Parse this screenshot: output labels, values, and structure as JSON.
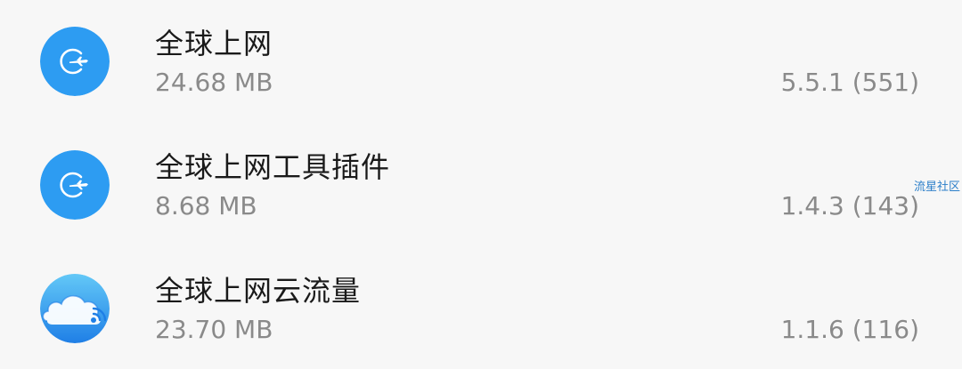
{
  "apps": [
    {
      "name": "全球上网",
      "size": "24.68 MB",
      "version": "5.5.1 (551)",
      "icon": "airplane-globe-icon"
    },
    {
      "name": "全球上网工具插件",
      "size": "8.68 MB",
      "version": "1.4.3 (143)",
      "icon": "airplane-globe-icon"
    },
    {
      "name": "全球上网云流量",
      "size": "23.70 MB",
      "version": "1.1.6 (116)",
      "icon": "cloud-signal-icon"
    }
  ],
  "watermark": "流星社区",
  "colors": {
    "background": "#f7f7f7",
    "icon_blue": "#2d9cf2",
    "text_primary": "#1a1a1a",
    "text_secondary": "#8a8a8a",
    "watermark": "#2c7fc9"
  }
}
